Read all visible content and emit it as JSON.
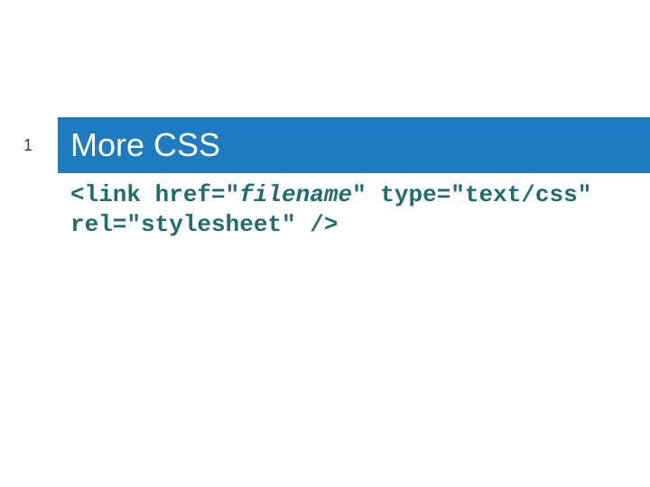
{
  "page_number": "1",
  "title": "More CSS",
  "code": {
    "p1": "<link href=\"",
    "filename": "filename",
    "p2": "\" type=\"text/css\" rel=\"stylesheet\" />"
  }
}
